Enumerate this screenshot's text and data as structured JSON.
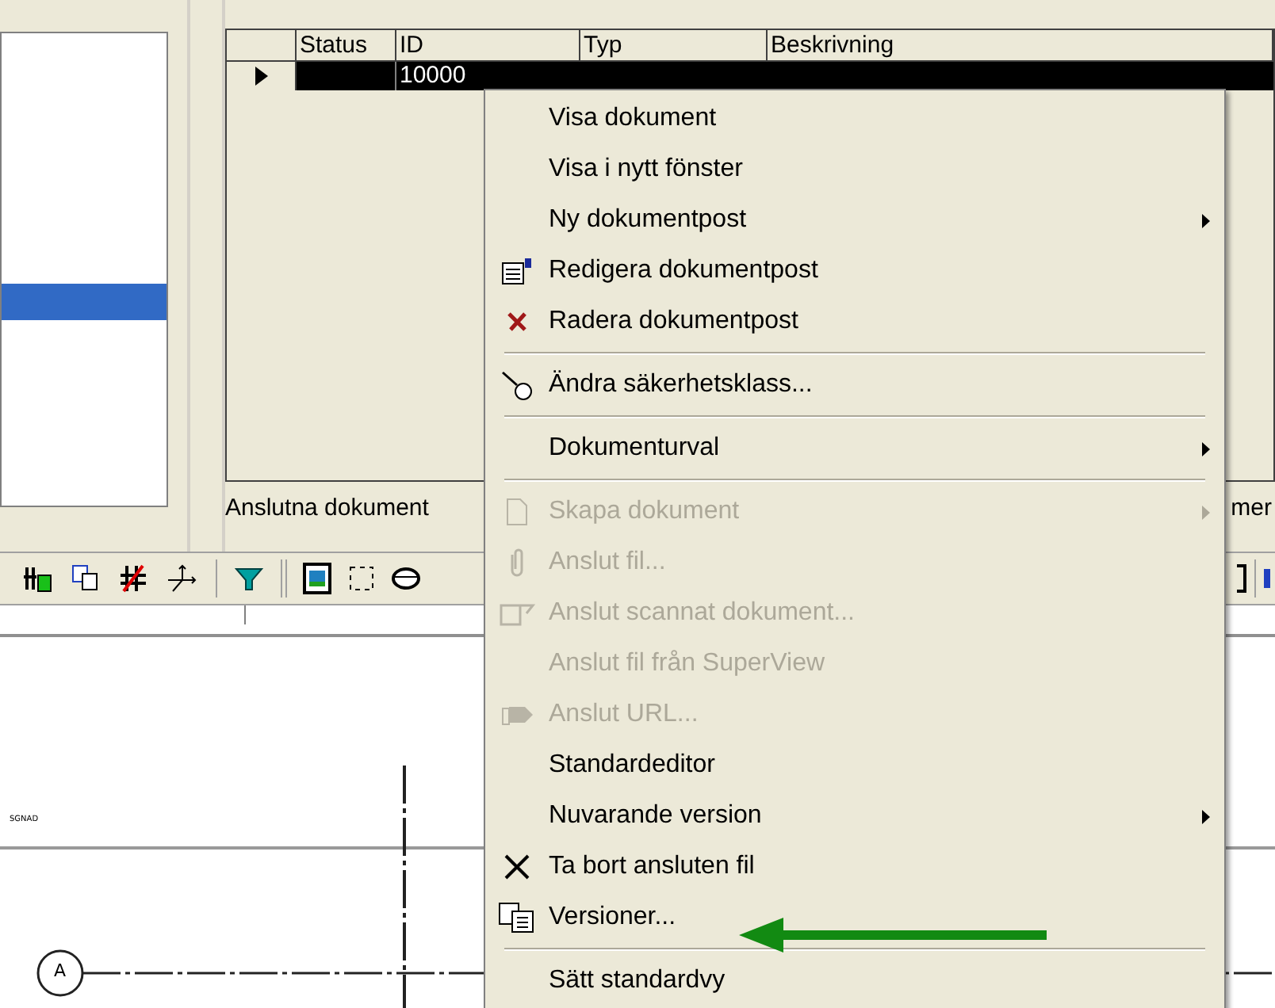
{
  "grid": {
    "columns": [
      "Status",
      "ID",
      "Typ",
      "Beskrivning"
    ],
    "rows": [
      {
        "selected": true,
        "id": "10000"
      }
    ]
  },
  "status_bar": {
    "left": "Anslutna dokument",
    "right": "mer"
  },
  "drawing": {
    "label": "SGNAD",
    "axis_label": "A"
  },
  "context_menu": {
    "items": [
      {
        "kind": "item",
        "label": "Visa dokument",
        "disabled": false,
        "submenu": false
      },
      {
        "kind": "item",
        "label": "Visa i nytt fönster",
        "disabled": false,
        "submenu": false
      },
      {
        "kind": "item",
        "label": "Ny dokumentpost",
        "disabled": false,
        "submenu": true
      },
      {
        "kind": "item",
        "label": "Redigera dokumentpost",
        "disabled": false,
        "submenu": false
      },
      {
        "kind": "item",
        "label": "Radera dokumentpost",
        "disabled": false,
        "submenu": false
      },
      {
        "kind": "separator"
      },
      {
        "kind": "item",
        "label": "Ändra säkerhetsklass...",
        "disabled": false,
        "submenu": false
      },
      {
        "kind": "separator"
      },
      {
        "kind": "item",
        "label": "Dokumenturval",
        "disabled": false,
        "submenu": true
      },
      {
        "kind": "separator"
      },
      {
        "kind": "item",
        "label": "Skapa dokument",
        "disabled": true,
        "submenu": true
      },
      {
        "kind": "item",
        "label": "Anslut fil...",
        "disabled": true,
        "submenu": false
      },
      {
        "kind": "item",
        "label": "Anslut scannat dokument...",
        "disabled": true,
        "submenu": false
      },
      {
        "kind": "item",
        "label": "Anslut fil från SuperView",
        "disabled": true,
        "submenu": false
      },
      {
        "kind": "item",
        "label": "Anslut URL...",
        "disabled": true,
        "submenu": false
      },
      {
        "kind": "item",
        "label": "Standardeditor",
        "disabled": false,
        "submenu": false
      },
      {
        "kind": "item",
        "label": "Nuvarande version",
        "disabled": false,
        "submenu": true
      },
      {
        "kind": "item",
        "label": "Ta bort ansluten fil",
        "disabled": false,
        "submenu": false
      },
      {
        "kind": "item",
        "label": "Versioner...",
        "disabled": false,
        "submenu": false
      },
      {
        "kind": "separator"
      },
      {
        "kind": "item",
        "label": "Sätt standardvy",
        "disabled": false,
        "submenu": false
      }
    ]
  }
}
